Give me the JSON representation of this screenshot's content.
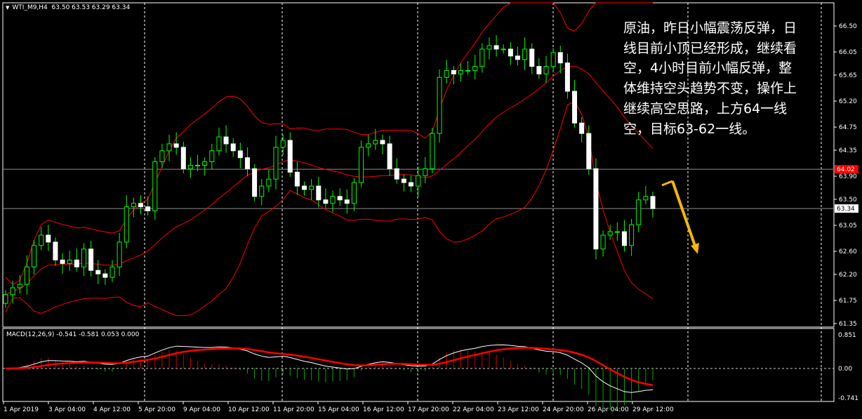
{
  "header": {
    "symbol": "WTI_M9,H4",
    "ohlc": "63.50 63.53 63.29 63.34"
  },
  "macd_header": "MACD(12,26,9) -0.541 -0.581 0.053 0.000",
  "annotation": "原油，昨日小幅震荡反弹，日\n线目前小顶已经形成，继续看\n空，4小时目前小幅反弹，整\n体维持空头趋势不变，操作上\n继续高空思路，上方64一线\n空，目标63-62一线。",
  "colors": {
    "bull": "#00ff00",
    "bear": "#ffffff",
    "bands": "#ff0000",
    "signal": "#ff0000",
    "arrow": "#f5b800",
    "price_tag": "#ff0000"
  },
  "chart_data": {
    "type": "candlestick",
    "title": "WTI_M9,H4",
    "ylim": [
      61.35,
      66.5
    ],
    "y_ticks": [
      "66.50",
      "66.05",
      "65.65",
      "65.20",
      "64.75",
      "64.35",
      "63.90",
      "63.50",
      "63.05",
      "62.60",
      "62.20",
      "61.75",
      "61.35"
    ],
    "x_ticks": [
      "1 Apr 2019",
      "3 Apr 04:00",
      "4 Apr 12:00",
      "5 Apr 20:00",
      "9 Apr 04:00",
      "10 Apr 12:00",
      "11 Apr 20:00",
      "15 Apr 04:00",
      "16 Apr 12:00",
      "17 Apr 20:00",
      "22 Apr 04:00",
      "23 Apr 12:00",
      "24 Apr 20:00",
      "26 Apr 04:00",
      "29 Apr 12:00"
    ],
    "closes": [
      61.85,
      61.97,
      62.03,
      62.33,
      62.7,
      62.88,
      62.76,
      62.45,
      62.39,
      62.45,
      62.33,
      62.64,
      62.27,
      62.21,
      62.15,
      62.33,
      62.76,
      63.37,
      63.43,
      63.37,
      63.3,
      64.15,
      64.34,
      64.46,
      64.4,
      64.03,
      64.09,
      64.09,
      64.15,
      64.34,
      64.58,
      64.46,
      64.34,
      64.22,
      64.03,
      63.55,
      63.73,
      63.85,
      64.4,
      64.52,
      63.97,
      63.73,
      63.67,
      63.73,
      63.49,
      63.43,
      63.55,
      63.49,
      63.43,
      63.79,
      64.4,
      64.46,
      64.52,
      64.46,
      64.03,
      63.85,
      63.79,
      63.73,
      63.91,
      64.03,
      64.64,
      65.61,
      65.73,
      65.67,
      65.73,
      65.73,
      65.8,
      66.1,
      66.16,
      66.1,
      66.1,
      65.98,
      65.92,
      66.1,
      65.8,
      65.67,
      65.8,
      66.04,
      65.86,
      65.37,
      64.82,
      64.64,
      64.03,
      62.64,
      62.88,
      62.94,
      62.94,
      62.7,
      63.06,
      63.49,
      63.55,
      63.34
    ],
    "first_open": 61.7,
    "hlines": [
      {
        "price": 64.02,
        "label": "64.02",
        "tag": "red"
      },
      {
        "price": 63.34,
        "label": "63.34",
        "tag": "white"
      }
    ],
    "bollinger": {
      "period": 20,
      "deviations": 2
    },
    "macd": {
      "fast": 12,
      "slow": 26,
      "signal": 9,
      "ylim": [
        -0.741,
        0.851
      ],
      "y_ticks": [
        "0.851",
        "0.00",
        "-0.741"
      ]
    }
  }
}
